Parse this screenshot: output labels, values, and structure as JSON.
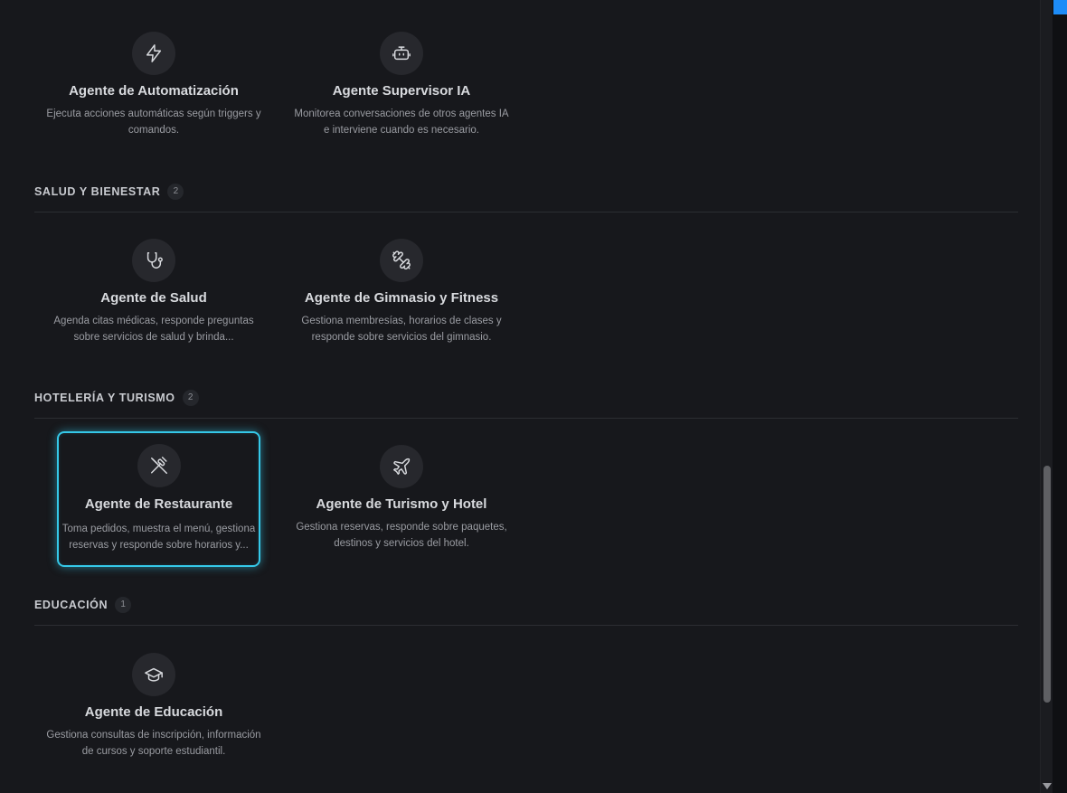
{
  "sections": [
    {
      "agents": [
        {
          "icon": "lightning-icon",
          "title": "Agente de Automatización",
          "description": "Ejecuta acciones automáticas según triggers y comandos."
        },
        {
          "icon": "robot-icon",
          "title": "Agente Supervisor IA",
          "description": "Monitorea conversaciones de otros agentes IA e interviene cuando es necesario."
        }
      ]
    },
    {
      "title": "SALUD Y BIENESTAR",
      "count": "2",
      "agents": [
        {
          "icon": "stethoscope-icon",
          "title": "Agente de Salud",
          "description": "Agenda citas médicas, responde preguntas sobre servicios de salud y brinda..."
        },
        {
          "icon": "dumbbell-icon",
          "title": "Agente de Gimnasio y Fitness",
          "description": "Gestiona membresías, horarios de clases y responde sobre servicios del gimnasio."
        }
      ]
    },
    {
      "title": "HOTELERÍA Y TURISMO",
      "count": "2",
      "agents": [
        {
          "icon": "utensils-icon",
          "title": "Agente de Restaurante",
          "description": "Toma pedidos, muestra el menú, gestiona reservas y responde sobre horarios y..."
        },
        {
          "icon": "plane-icon",
          "title": "Agente de Turismo y Hotel",
          "description": "Gestiona reservas, responde sobre paquetes, destinos y servicios del hotel."
        }
      ]
    },
    {
      "title": "EDUCACIÓN",
      "count": "1",
      "agents": [
        {
          "icon": "graduation-cap-icon",
          "title": "Agente de Educación",
          "description": "Gestiona consultas de inscripción, información de cursos y soporte estudiantil."
        }
      ]
    }
  ],
  "selected_agent": "Agente de Restaurante",
  "colors": {
    "background": "#17181c",
    "selection_accent": "#35c8e8",
    "icon_circle": "#27282d"
  }
}
